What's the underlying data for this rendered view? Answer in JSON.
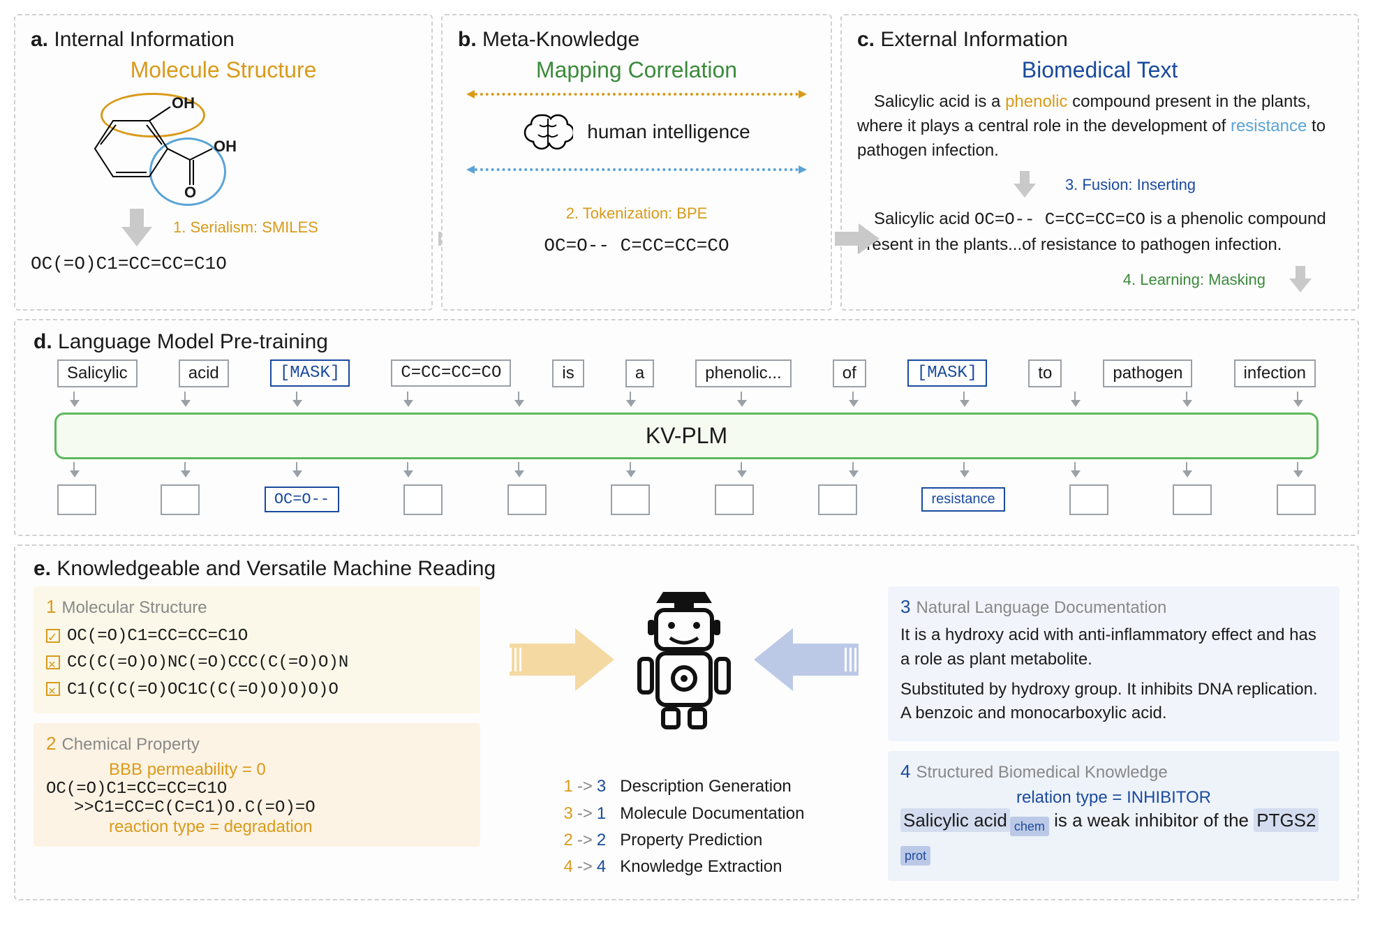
{
  "panels": {
    "a": {
      "title_letter": "a.",
      "title": "Internal Information",
      "subtitle": "Molecule Structure",
      "label_OH": "OH",
      "label_OOH": "OH",
      "label_O": "O",
      "step": "1. Serialism: SMILES",
      "smiles": "OC(=O)C1=CC=CC=C1O"
    },
    "b": {
      "title_letter": "b.",
      "title": "Meta-Knowledge",
      "subtitle": "Mapping Correlation",
      "brain_label": "human intelligence",
      "step": "2. Tokenization: BPE",
      "tokens": "OC=O--  C=CC=CC=CO"
    },
    "c": {
      "title_letter": "c.",
      "title": "External Information",
      "subtitle": "Biomedical Text",
      "text1_pre": "Salicylic acid is a ",
      "text1_kw1": "phenolic",
      "text1_mid": " compound present in the plants, where it plays a central role in the development of ",
      "text1_kw2": "resistance",
      "text1_post": " to pathogen infection.",
      "step": "3. Fusion: Inserting",
      "text2_pre": "Salicylic acid ",
      "text2_smiles": "OC=O--  C=CC=CC=CO",
      "text2_post": " is a phenolic compound present in the plants...of resistance to pathogen infection.",
      "step_learn": "4. Learning: Masking"
    },
    "d": {
      "title_letter": "d.",
      "title": "Language Model Pre-training",
      "tokens_in": [
        "Salicylic",
        "acid",
        "[MASK]",
        "C=CC=CC=CO",
        "is",
        "a",
        "phenolic...",
        "of",
        "[MASK]",
        "to",
        "pathogen",
        "infection"
      ],
      "model_name": "KV-PLM",
      "tokens_out_pred1": "OC=O--",
      "tokens_out_pred2": "resistance"
    },
    "e": {
      "title_letter": "e.",
      "title": "Knowledgeable and Versatile Machine Reading",
      "card1": {
        "num": "1",
        "header": "Molecular Structure",
        "items": [
          {
            "ok": true,
            "text": "OC(=O)C1=CC=CC=C1O"
          },
          {
            "ok": false,
            "text": "CC(C(=O)O)NC(=O)CCC(C(=O)O)N"
          },
          {
            "ok": false,
            "text": "C1(C(C(=O)OC1C(C(=O)O)O)O)O"
          }
        ]
      },
      "card2": {
        "num": "2",
        "header": "Chemical Property",
        "ann1": "BBB permeability = 0",
        "line1": "OC(=O)C1=CC=CC=C1O",
        "line2": ">>C1=CC=C(C=C1)O.C(=O)=O",
        "ann2": "reaction type = degradation"
      },
      "card3": {
        "num": "3",
        "header": "Natural Language Documentation",
        "para1": "It is a hydroxy acid with anti-inflammatory effect and has a role as plant metabolite.",
        "para2": "Substituted by hydroxy group. It inhibits DNA replication. A benzoic and monocarboxylic acid."
      },
      "card4": {
        "num": "4",
        "header": "Structured Biomedical Knowledge",
        "rel": "relation type = INHIBITOR",
        "sent_pre": "Salicylic acid",
        "tag1": "chem",
        "sent_mid": "is a weak inhibitor of the ",
        "sent_ent2": "PTGS2",
        "tag2": "prot"
      },
      "tasks": [
        {
          "l": "1",
          "r": "3",
          "name": "Description Generation"
        },
        {
          "l": "3",
          "r": "1",
          "name": "Molecule Documentation"
        },
        {
          "l": "2",
          "r": "2",
          "name": "Property Prediction"
        },
        {
          "l": "4",
          "r": "4",
          "name": "Knowledge Extraction"
        }
      ]
    }
  }
}
